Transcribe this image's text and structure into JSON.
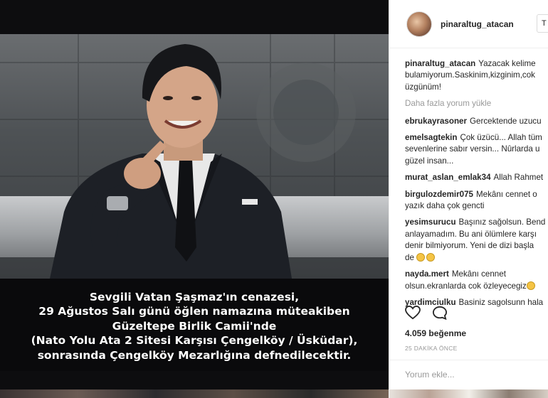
{
  "post": {
    "username": "pinaraltug_atacan",
    "follow_label": "T",
    "caption_text": "Yazacak kelime bulamiyorum.Saskinim,kizginim,cok üzgünüm!",
    "load_more": "Daha fazla yorum yükle",
    "image_caption_lines": [
      "Sevgili Vatan Şaşmaz'ın cenazesi,",
      "29 Ağustos Salı günü öğlen namazına müteakiben",
      "Güzeltepe Birlik Camii'nde",
      "(Nato Yolu Ata 2 Sitesi Karşısı Çengelköy / Üsküdar),",
      "sonrasında Çengelköy Mezarlığına defnedilecektir."
    ],
    "comments": [
      {
        "user": "ebrukayrasoner",
        "lines": [
          "Gercektende uzucu"
        ]
      },
      {
        "user": "emelsagtekin",
        "lines": [
          "Çok üzücü... Allah tüm",
          "sevenlerine sabır versin... Nûrlarda u",
          "güzel insan..."
        ]
      },
      {
        "user": "murat_aslan_emlak34",
        "lines": [
          "Allah Rahmet"
        ]
      },
      {
        "user": "birgulozdemir075",
        "lines": [
          "Mekânı cennet o",
          "yazık daha çok gencti"
        ]
      },
      {
        "user": "yesimsurucu",
        "lines": [
          "Başınız sağolsun. Bend",
          "anlayamadım. Bu ani ölümlere karşı",
          "denir bilmiyorum. Yeni de dizi başla",
          "de"
        ]
      },
      {
        "user": "nayda.mert",
        "lines": [
          "Mekânı cennet",
          "olsun.ekranlarda cok özleyecegiz"
        ]
      },
      {
        "user": "yardimciulku",
        "lines": [
          "Basiniz sagolsunn hala"
        ]
      }
    ],
    "likes": "4.059 beğenme",
    "time_ago": "25 DAKİKA ÖNCE",
    "add_comment_placeholder": "Yorum ekle..."
  },
  "icons": {
    "like": "heart-icon",
    "comment": "comment-bubble-icon",
    "emoji": "sad-face-emoji"
  }
}
